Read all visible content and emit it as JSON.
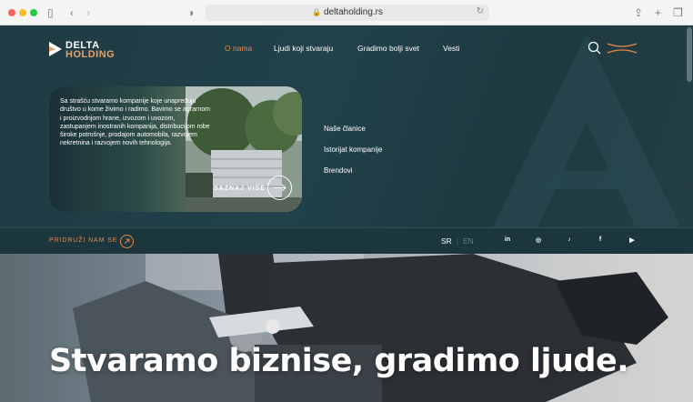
{
  "browser": {
    "url": "deltaholding.rs"
  },
  "site": {
    "logo": {
      "line1": "DELTA",
      "line2": "HOLDING"
    },
    "nav": [
      {
        "label": "O nama",
        "active": true
      },
      {
        "label": "Ljudi koji stvaraju",
        "active": false
      },
      {
        "label": "Gradimo bolji svet",
        "active": false
      },
      {
        "label": "Vesti",
        "active": false
      }
    ],
    "card": {
      "text": "Sa strašću stvaramo kompanije koje unapređuju društvo u kome živimo i radimo. Bavimo se agrarnom i proizvodnjom hrane, izvozom i uvozom, zastupanjem inostranih kompanija, distribucijom robe široke potrošnje, prodajom automobila, razvojem nekretnina i razvojem novih tehnologija.",
      "cta": "SAZNAJ VIŠE"
    },
    "side_links": [
      "Naše članice",
      "Istorijat kompanije",
      "Brendovi"
    ],
    "join": "PRIDRUŽI NAM SE",
    "languages": {
      "active": "SR",
      "inactive": "EN"
    },
    "social": [
      "in",
      "◎",
      "♪",
      "f",
      "▶"
    ],
    "headline": "Stvaramo biznise, gradimo ljude.",
    "colors": {
      "accent": "#e58a4f",
      "bg": "#1f3a42"
    }
  }
}
